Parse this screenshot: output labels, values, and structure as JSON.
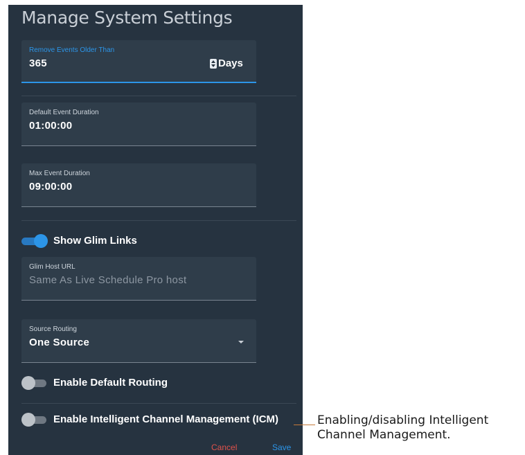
{
  "dialog": {
    "title": "Manage System Settings",
    "remove_events": {
      "label": "Remove Events Older Than",
      "value": "365",
      "suffix": "Days"
    },
    "default_duration": {
      "label": "Default Event Duration",
      "value": "01:00:00"
    },
    "max_duration": {
      "label": "Max Event Duration",
      "value": "09:00:00"
    },
    "show_glim_links": {
      "label": "Show Glim Links",
      "on": true
    },
    "glim_host_url": {
      "label": "Glim Host URL",
      "placeholder": "Same As Live Schedule Pro host"
    },
    "source_routing": {
      "label": "Source Routing",
      "value": "One Source"
    },
    "enable_default_routing": {
      "label": "Enable Default Routing",
      "on": false
    },
    "enable_icm": {
      "label": "Enable Intelligent Channel Management (ICM)",
      "on": false
    },
    "cancel_label": "Cancel",
    "save_label": "Save"
  },
  "annotation": {
    "line1": "Enabling/disabling Intelligent",
    "line2": "Channel Management."
  },
  "colors": {
    "panel_bg": "#263340",
    "field_bg": "#2f3d4a",
    "accent": "#2c95e8",
    "cancel": "#e0524b",
    "callout_line": "#c67a3a"
  }
}
